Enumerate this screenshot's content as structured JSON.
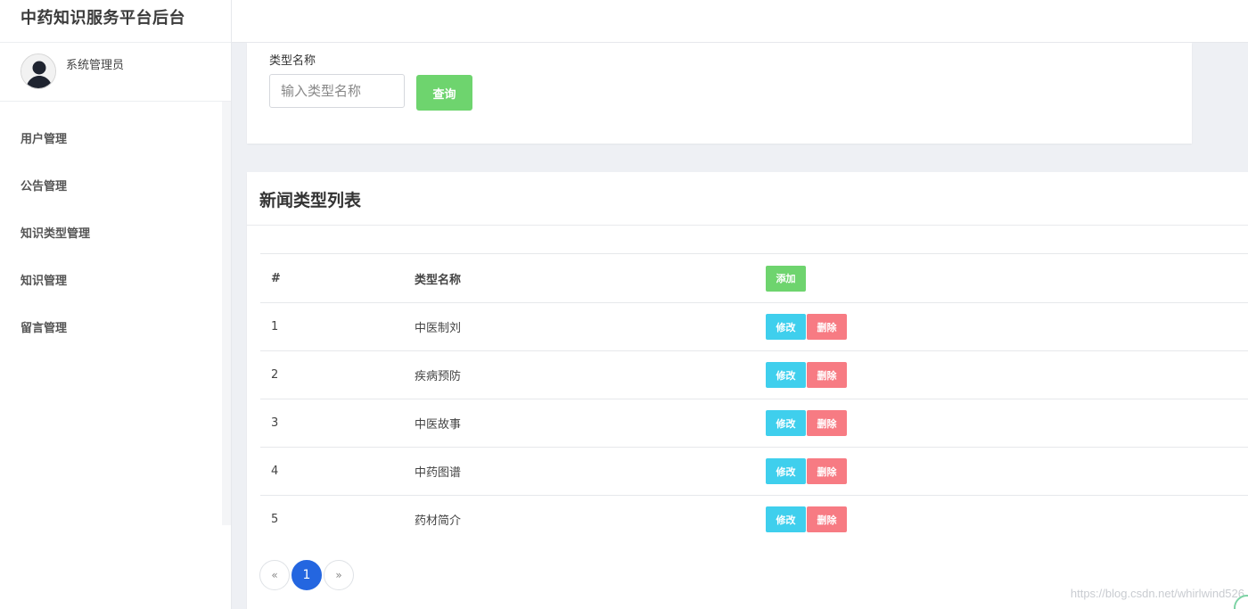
{
  "sidebar": {
    "brand": "中药知识服务平台后台",
    "user_name": "系统管理员",
    "items": [
      {
        "label": "用户管理"
      },
      {
        "label": "公告管理"
      },
      {
        "label": "知识类型管理"
      },
      {
        "label": "知识管理"
      },
      {
        "label": "留言管理"
      }
    ]
  },
  "search": {
    "label": "类型名称",
    "placeholder": "输入类型名称",
    "value": "",
    "button": "查询"
  },
  "list": {
    "title": "新闻类型列表",
    "headers": {
      "num": "#",
      "name": "类型名称",
      "add": "添加"
    },
    "rows": [
      {
        "num": "1",
        "name": "中医制刘",
        "edit": "修改",
        "delete": "删除"
      },
      {
        "num": "2",
        "name": "疾病预防",
        "edit": "修改",
        "delete": "删除"
      },
      {
        "num": "3",
        "name": "中医故事",
        "edit": "修改",
        "delete": "删除"
      },
      {
        "num": "4",
        "name": "中药图谱",
        "edit": "修改",
        "delete": "删除"
      },
      {
        "num": "5",
        "name": "药材简介",
        "edit": "修改",
        "delete": "删除"
      }
    ]
  },
  "pagination": {
    "prev": "«",
    "current": "1",
    "next": "»"
  },
  "watermark": "https://blog.csdn.net/whirlwind526",
  "colors": {
    "success": "#6ed46e",
    "info": "#3fcfed",
    "danger": "#f77b83",
    "primary": "#2466e0"
  },
  "icons": {
    "avatar": "user-avatar-icon"
  }
}
